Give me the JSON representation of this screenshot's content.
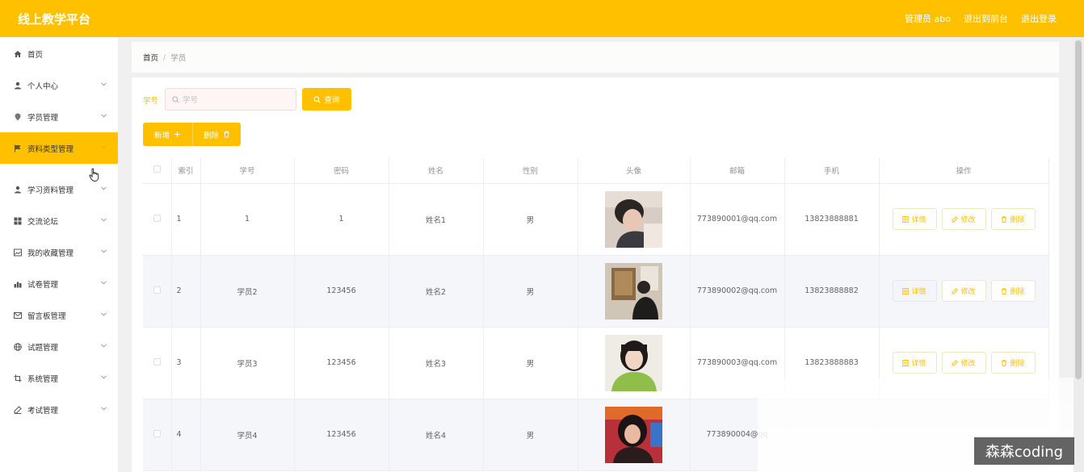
{
  "app": {
    "title": "线上教学平台"
  },
  "topbar": {
    "user": "管理员 abo",
    "front": "退出到前台",
    "logout": "退出登录"
  },
  "sidebar": {
    "items": [
      {
        "label": "首页",
        "icon": "home-icon",
        "expandable": false
      },
      {
        "label": "个人中心",
        "icon": "user-icon",
        "expandable": true
      },
      {
        "label": "学员管理",
        "icon": "location-icon",
        "expandable": true
      },
      {
        "label": "资料类型管理",
        "icon": "flag-icon",
        "expandable": true,
        "active": true
      },
      {
        "label": "学习资料管理",
        "icon": "user-icon",
        "expandable": true
      },
      {
        "label": "交流论坛",
        "icon": "grid-icon",
        "expandable": true
      },
      {
        "label": "我的收藏管理",
        "icon": "picture-icon",
        "expandable": true
      },
      {
        "label": "试卷管理",
        "icon": "chart-icon",
        "expandable": true
      },
      {
        "label": "留言板管理",
        "icon": "message-icon",
        "expandable": true
      },
      {
        "label": "试题管理",
        "icon": "globe-icon",
        "expandable": true
      },
      {
        "label": "系统管理",
        "icon": "crop-icon",
        "expandable": true
      },
      {
        "label": "考试管理",
        "icon": "edit-icon",
        "expandable": true
      }
    ]
  },
  "breadcrumb": {
    "home": "首页",
    "sep": "/",
    "current": "学员"
  },
  "search": {
    "label": "学号",
    "placeholder": "学号",
    "query_label": "查询"
  },
  "actions": {
    "add_label": "新增",
    "delete_label": "删除"
  },
  "table": {
    "headers": [
      "",
      "索引",
      "学号",
      "密码",
      "姓名",
      "性别",
      "头像",
      "邮箱",
      "手机",
      "操作"
    ],
    "op_labels": {
      "detail": "详情",
      "edit": "修改",
      "delete": "删除"
    },
    "rows": [
      {
        "index": "1",
        "student_no": "1",
        "password": "1",
        "name": "姓名1",
        "gender": "男",
        "email": "773890001@qq.com",
        "phone": "13823888881"
      },
      {
        "index": "2",
        "student_no": "学员2",
        "password": "123456",
        "name": "姓名2",
        "gender": "男",
        "email": "773890002@qq.com",
        "phone": "13823888882"
      },
      {
        "index": "3",
        "student_no": "学员3",
        "password": "123456",
        "name": "姓名3",
        "gender": "男",
        "email": "773890003@qq.com",
        "phone": "13823888883"
      },
      {
        "index": "4",
        "student_no": "学员4",
        "password": "123456",
        "name": "姓名4",
        "gender": "男",
        "email": "773890004@qq",
        "phone": ""
      }
    ]
  },
  "watermark": "森森coding",
  "colors": {
    "accent": "#ffc000",
    "stripe": "#f5f6fa"
  }
}
